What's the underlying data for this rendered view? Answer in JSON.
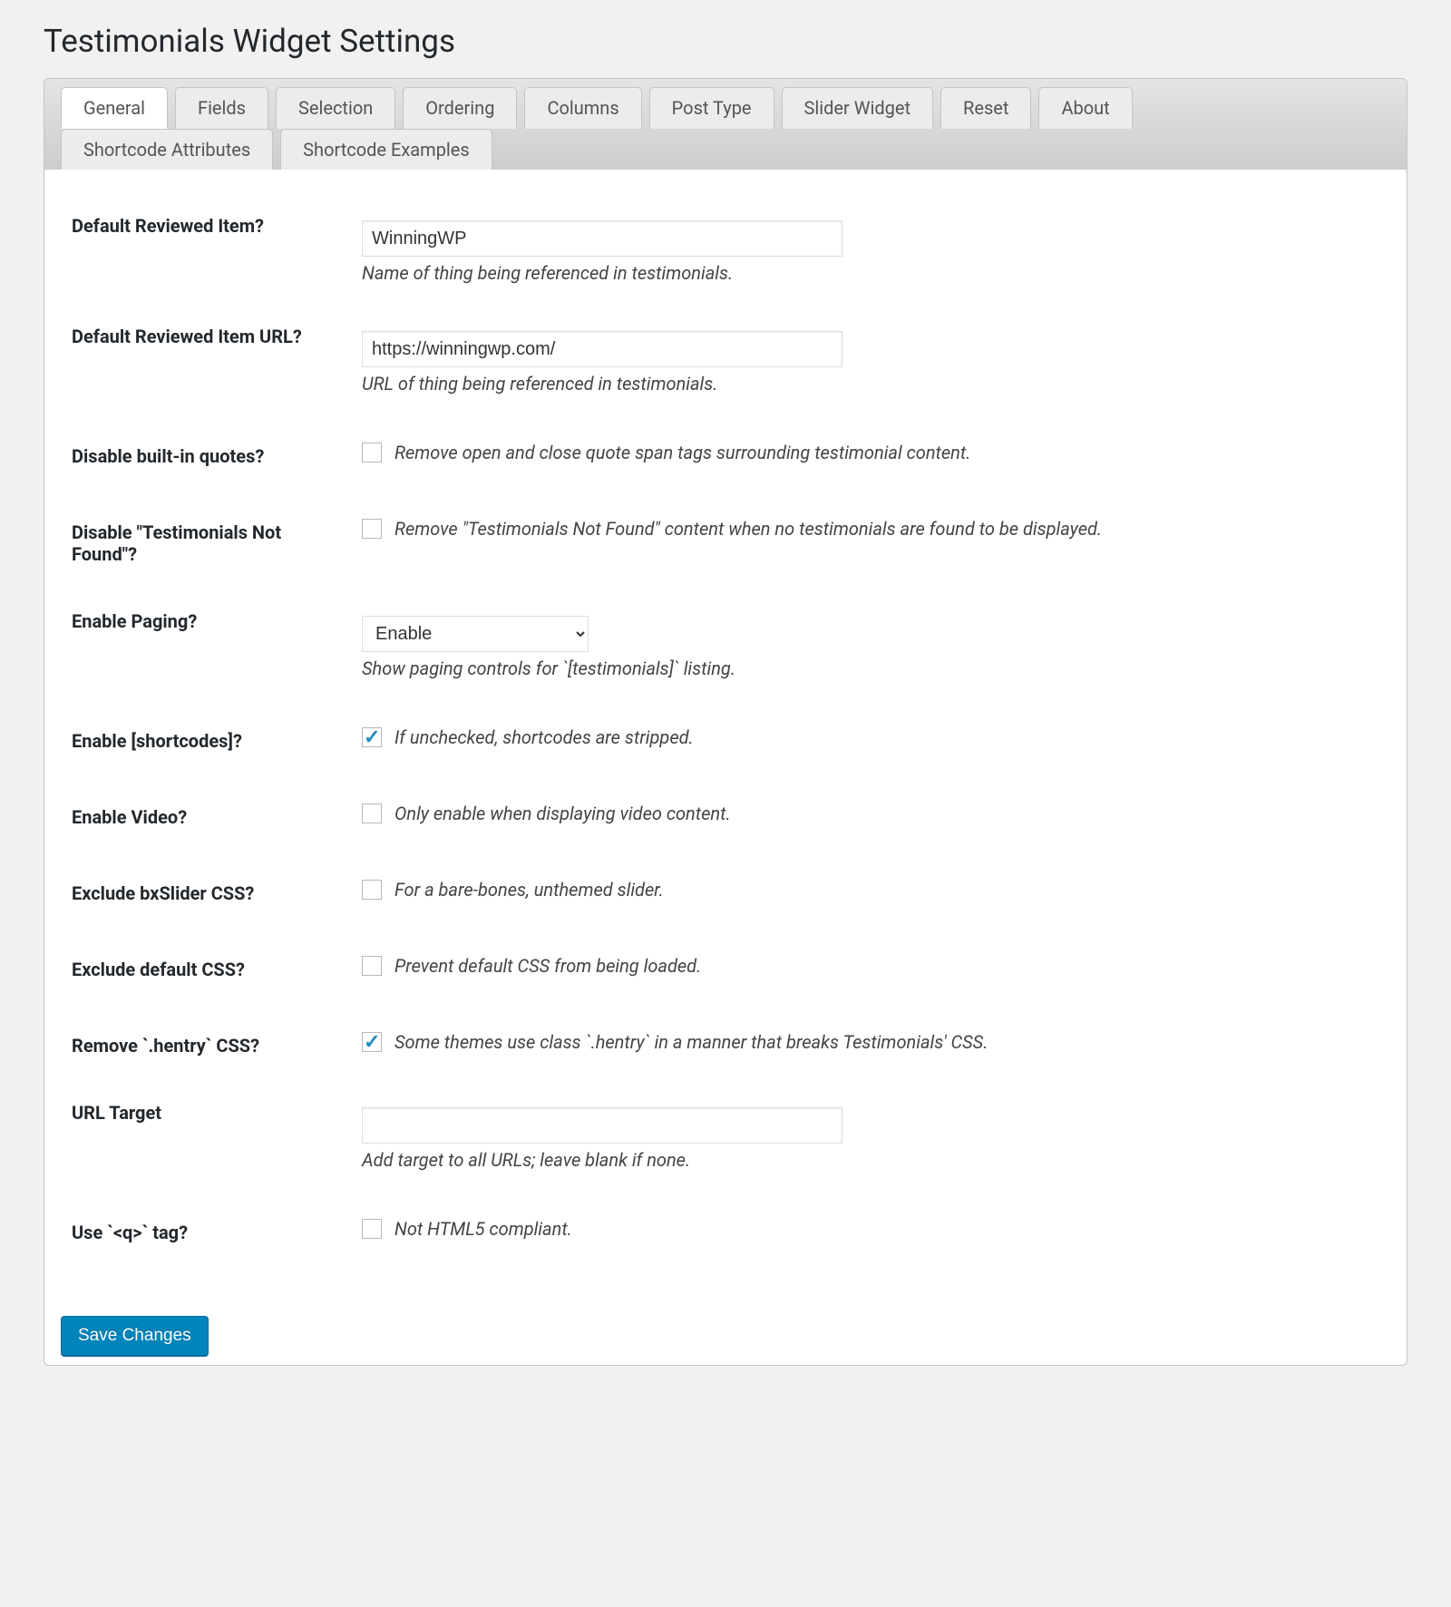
{
  "page_title": "Testimonials Widget Settings",
  "tabs": {
    "row1": [
      {
        "label": "General",
        "active": true
      },
      {
        "label": "Fields",
        "active": false
      },
      {
        "label": "Selection",
        "active": false
      },
      {
        "label": "Ordering",
        "active": false
      },
      {
        "label": "Columns",
        "active": false
      },
      {
        "label": "Post Type",
        "active": false
      },
      {
        "label": "Slider Widget",
        "active": false
      },
      {
        "label": "Reset",
        "active": false
      },
      {
        "label": "About",
        "active": false
      }
    ],
    "row2": [
      {
        "label": "Shortcode Attributes",
        "active": false
      },
      {
        "label": "Shortcode Examples",
        "active": false
      }
    ]
  },
  "fields": {
    "reviewed_item": {
      "label": "Default Reviewed Item?",
      "value": "WinningWP",
      "description": "Name of thing being referenced in testimonials."
    },
    "reviewed_item_url": {
      "label": "Default Reviewed Item URL?",
      "value": "https://winningwp.com/",
      "description": "URL of thing being referenced in testimonials."
    },
    "disable_quotes": {
      "label": "Disable built-in quotes?",
      "checked": false,
      "description": "Remove open and close quote span tags surrounding testimonial content."
    },
    "disable_not_found": {
      "label": "Disable \"Testimonials Not Found\"?",
      "checked": false,
      "description": "Remove \"Testimonials Not Found\" content when no testimonials are found to be displayed."
    },
    "enable_paging": {
      "label": "Enable Paging?",
      "value": "Enable",
      "description": "Show paging controls for `[testimonials]` listing."
    },
    "enable_shortcodes": {
      "label": "Enable [shortcodes]?",
      "checked": true,
      "description": "If unchecked, shortcodes are stripped."
    },
    "enable_video": {
      "label": "Enable Video?",
      "checked": false,
      "description": "Only enable when displaying video content."
    },
    "exclude_bxslider_css": {
      "label": "Exclude bxSlider CSS?",
      "checked": false,
      "description": "For a bare-bones, unthemed slider."
    },
    "exclude_default_css": {
      "label": "Exclude default CSS?",
      "checked": false,
      "description": "Prevent default CSS from being loaded."
    },
    "remove_hentry_css": {
      "label": "Remove `.hentry` CSS?",
      "checked": true,
      "description": "Some themes use class `.hentry` in a manner that breaks Testimonials' CSS."
    },
    "url_target": {
      "label": "URL Target",
      "value": "",
      "description": "Add target to all URLs; leave blank if none."
    },
    "use_q_tag": {
      "label": "Use `<q>` tag?",
      "checked": false,
      "description": "Not HTML5 compliant."
    }
  },
  "submit_label": "Save Changes"
}
